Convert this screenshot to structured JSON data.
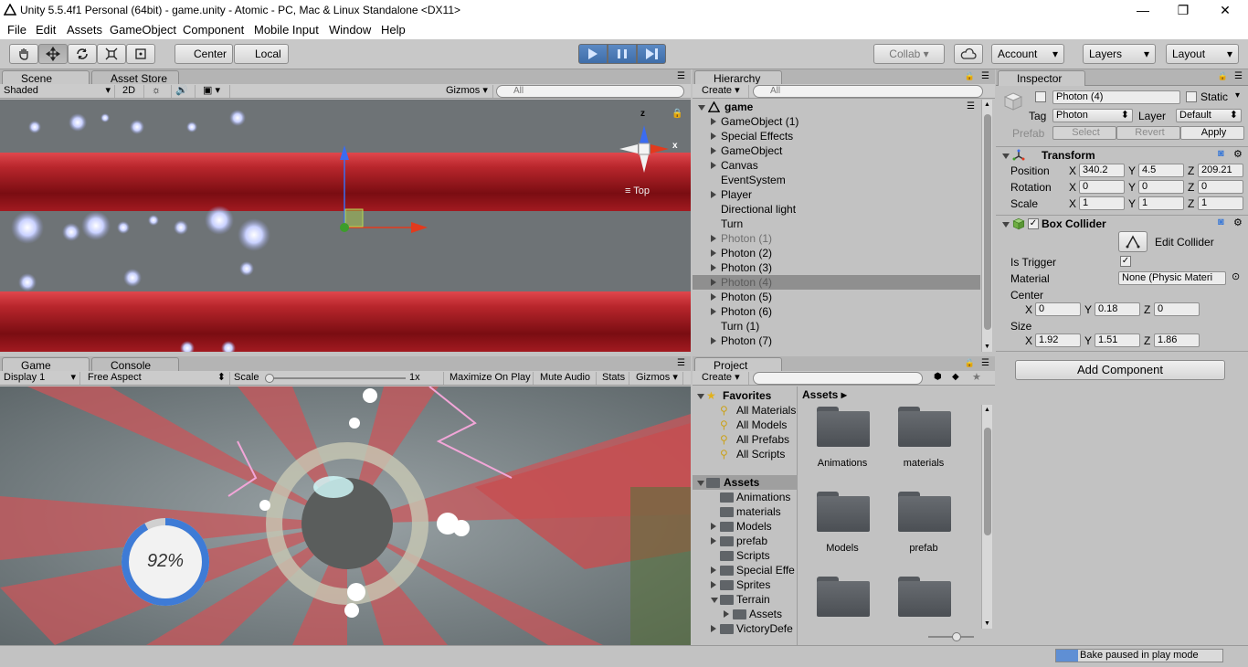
{
  "window": {
    "title": "Unity 5.5.4f1 Personal (64bit) - game.unity - Atomic - PC, Mac & Linux Standalone <DX11>",
    "minimize": "—",
    "restore": "❐",
    "close": "✕"
  },
  "menu": [
    "File",
    "Edit",
    "Assets",
    "GameObject",
    "Component",
    "Mobile Input",
    "Window",
    "Help"
  ],
  "toolbar": {
    "center": "Center",
    "local": "Local",
    "collab": "Collab",
    "account": "Account",
    "layers": "Layers",
    "layout": "Layout"
  },
  "scene": {
    "tab": "Scene",
    "tab2": "Asset Store",
    "shading": "Shaded",
    "mode2d": "2D",
    "gizmos": "Gizmos",
    "search_placeholder": "All",
    "view_label": "Top",
    "axis_z": "z",
    "axis_x": "x"
  },
  "game": {
    "tab": "Game",
    "tab2": "Console",
    "display": "Display 1",
    "aspect": "Free Aspect",
    "scale_label": "Scale",
    "scale_value": "1x",
    "maximize": "Maximize On Play",
    "mute": "Mute Audio",
    "stats": "Stats",
    "gizmos": "Gizmos",
    "progress_text": "92%",
    "progress": 0.92
  },
  "hierarchy": {
    "tab": "Hierarchy",
    "create": "Create",
    "search_placeholder": "All",
    "scene_name": "game",
    "items": [
      {
        "label": "GameObject (1)",
        "expand": true,
        "dim": false
      },
      {
        "label": "Special Effects",
        "expand": true,
        "dim": false
      },
      {
        "label": "GameObject",
        "expand": true,
        "dim": false
      },
      {
        "label": "Canvas",
        "expand": true,
        "dim": false
      },
      {
        "label": "EventSystem",
        "expand": false,
        "dim": false
      },
      {
        "label": "Player",
        "expand": true,
        "dim": false
      },
      {
        "label": "Directional light",
        "expand": false,
        "dim": false
      },
      {
        "label": "Turn",
        "expand": false,
        "dim": false
      },
      {
        "label": "Photon (1)",
        "expand": true,
        "dim": true
      },
      {
        "label": "Photon (2)",
        "expand": true,
        "dim": false
      },
      {
        "label": "Photon (3)",
        "expand": true,
        "dim": false
      },
      {
        "label": "Photon (4)",
        "expand": true,
        "dim": true,
        "selected": true
      },
      {
        "label": "Photon (5)",
        "expand": true,
        "dim": false
      },
      {
        "label": "Photon (6)",
        "expand": true,
        "dim": false
      },
      {
        "label": "Turn (1)",
        "expand": false,
        "dim": false
      },
      {
        "label": "Photon (7)",
        "expand": true,
        "dim": false
      }
    ]
  },
  "project": {
    "tab": "Project",
    "create": "Create",
    "favorites_label": "Favorites",
    "favorites": [
      "All Materials",
      "All Models",
      "All Prefabs",
      "All Scripts"
    ],
    "assets_label": "Assets",
    "tree": [
      {
        "label": "Animations",
        "expand": false,
        "indent": 0
      },
      {
        "label": "materials",
        "expand": false,
        "indent": 0
      },
      {
        "label": "Models",
        "expand": true,
        "indent": 0
      },
      {
        "label": "prefab",
        "expand": true,
        "indent": 0
      },
      {
        "label": "Scripts",
        "expand": false,
        "indent": 0
      },
      {
        "label": "Special Effe",
        "expand": true,
        "indent": 0
      },
      {
        "label": "Sprites",
        "expand": true,
        "indent": 0
      },
      {
        "label": "Terrain",
        "expand": "open",
        "indent": 0
      },
      {
        "label": "Assets",
        "expand": true,
        "indent": 1
      },
      {
        "label": "VictoryDefe",
        "expand": true,
        "indent": 0
      }
    ],
    "breadcrumb": "Assets",
    "folders": [
      "Animations",
      "materials",
      "Models",
      "prefab",
      "",
      ""
    ]
  },
  "inspector": {
    "tab": "Inspector",
    "name": "Photon (4)",
    "static": "Static",
    "tag_label": "Tag",
    "tag": "Photon",
    "layer_label": "Layer",
    "layer": "Default",
    "prefab_label": "Prefab",
    "select": "Select",
    "revert": "Revert",
    "apply": "Apply",
    "transform": {
      "title": "Transform",
      "position_label": "Position",
      "position": [
        "340.2",
        "4.5",
        "209.21"
      ],
      "rotation_label": "Rotation",
      "rotation": [
        "0",
        "0",
        "0"
      ],
      "scale_label": "Scale",
      "scale": [
        "1",
        "1",
        "1"
      ]
    },
    "collider": {
      "title": "Box Collider",
      "edit": "Edit Collider",
      "trigger_label": "Is Trigger",
      "material_label": "Material",
      "material": "None (Physic Materi",
      "center_label": "Center",
      "center": [
        "0",
        "0.18",
        "0"
      ],
      "size_label": "Size",
      "size": [
        "1.92",
        "1.51",
        "1.86"
      ]
    },
    "add_component": "Add Component",
    "axis": [
      "X",
      "Y",
      "Z"
    ]
  },
  "status": {
    "text": "Bake paused in play mode"
  },
  "colors": {
    "accent": "#3e7bd6",
    "selection": "#8f8f8f",
    "tube": "#b01c22"
  }
}
